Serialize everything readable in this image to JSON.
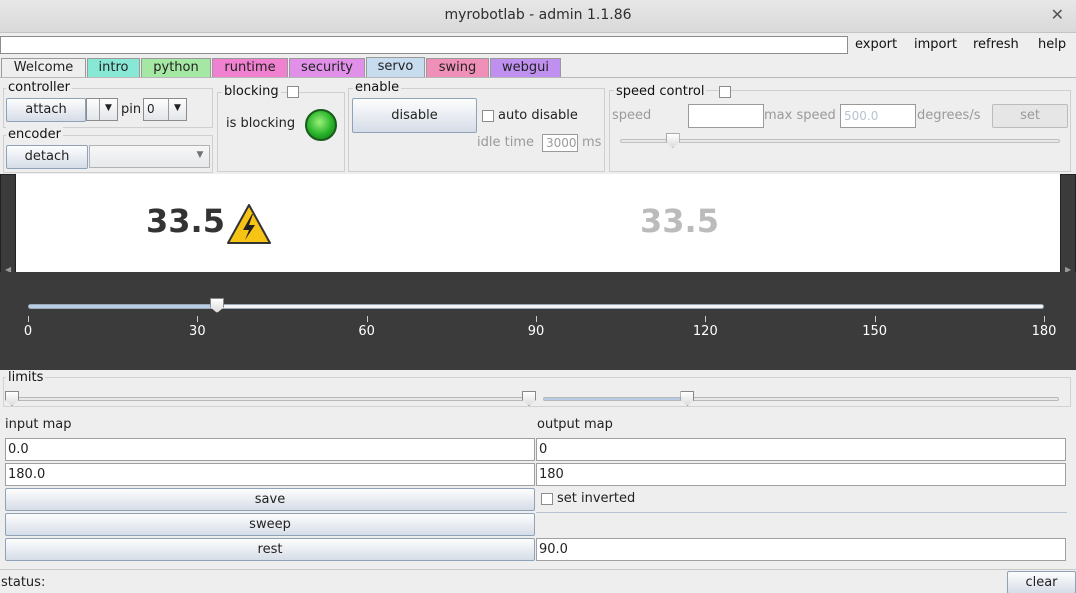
{
  "window": {
    "title": "myrobotlab - admin 1.1.86",
    "close": "✕"
  },
  "topbar": {
    "input_value": "",
    "menu": [
      "export",
      "import",
      "refresh",
      "help"
    ]
  },
  "tabs": [
    {
      "label": "Welcome",
      "color": "#eeeeee"
    },
    {
      "label": "intro",
      "color": "#88e8d6"
    },
    {
      "label": "python",
      "color": "#a4e8a4"
    },
    {
      "label": "runtime",
      "color": "#f080d0"
    },
    {
      "label": "security",
      "color": "#e090e8"
    },
    {
      "label": "servo",
      "color": "#c8dcf0"
    },
    {
      "label": "swing",
      "color": "#f090b8"
    },
    {
      "label": "webgui",
      "color": "#c090f0"
    }
  ],
  "controller": {
    "title": "controller",
    "attach": "attach",
    "pin_label": "pin",
    "pin_value": "0"
  },
  "encoder": {
    "title": "encoder",
    "detach": "detach"
  },
  "blocking": {
    "title": "blocking",
    "is_blocking": "is blocking"
  },
  "enable": {
    "title": "enable",
    "disable": "disable",
    "auto_disable": "auto disable",
    "idle_time": "idle time",
    "idle_value": "3000",
    "ms": "ms"
  },
  "speed": {
    "title": "speed control",
    "speed_label": "speed",
    "speed_value": "",
    "max_speed_label": "max speed",
    "max_speed_value": "500.0",
    "unit": "degrees/s",
    "set": "set",
    "slider_level": 0.12
  },
  "servo": {
    "current_pos": "33.5",
    "target_pos": "33.5",
    "slider_value": 33.5,
    "min": 0,
    "max": 180,
    "ticks": [
      "0",
      "30",
      "60",
      "90",
      "120",
      "150",
      "180"
    ]
  },
  "limits": {
    "title": "limits",
    "input_min": 0,
    "input_max": 180,
    "output_level": 0.28
  },
  "maps": {
    "input_label": "input map",
    "output_label": "output map",
    "input_min": "0.0",
    "input_max": "180.0",
    "output_min": "0",
    "output_max": "180",
    "save": "save",
    "sweep": "sweep",
    "rest": "rest",
    "set_inverted": "set inverted",
    "rest_value": "90.0"
  },
  "status": {
    "label": "status:",
    "clear": "clear"
  }
}
